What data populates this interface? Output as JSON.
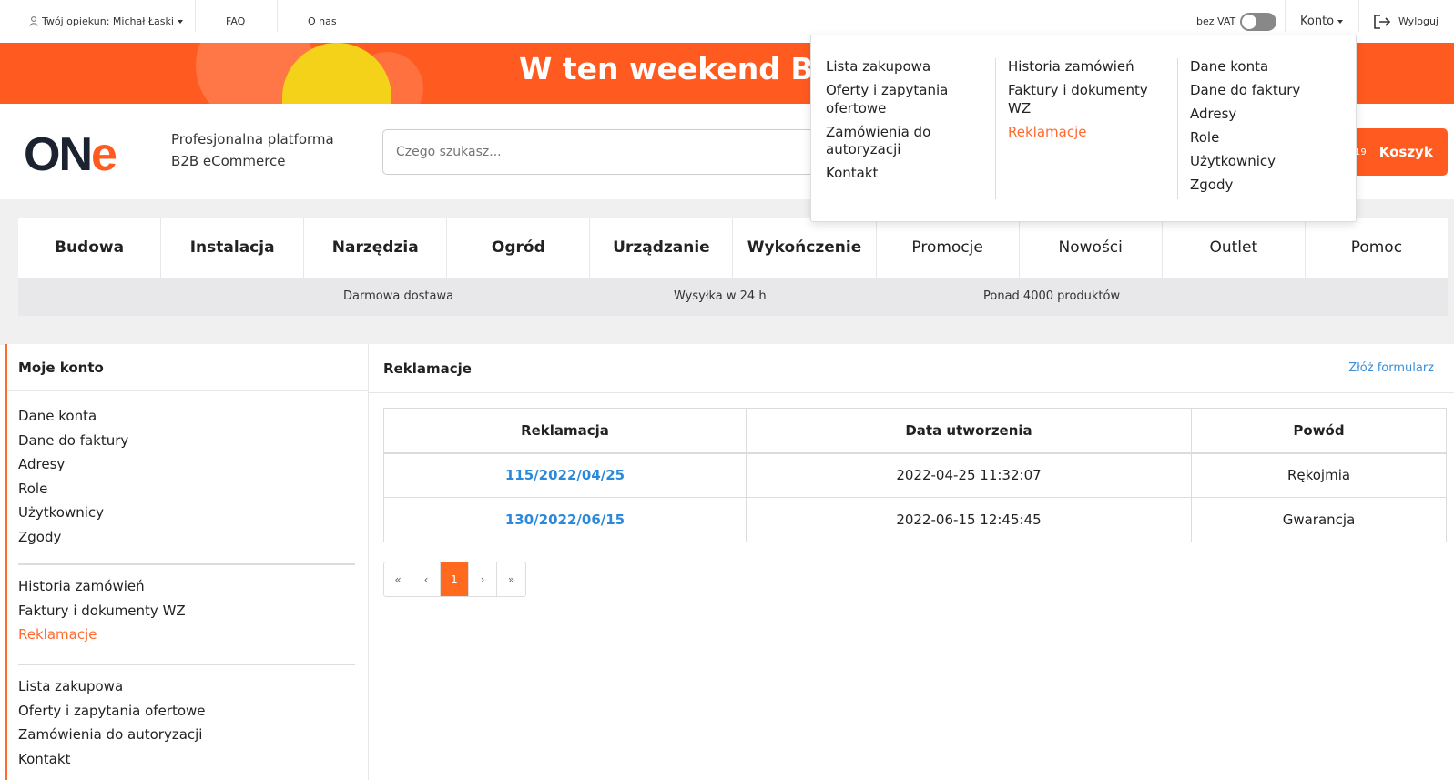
{
  "topbar": {
    "advisor": "Twój opiekun: Michał Łaski",
    "faq": "FAQ",
    "about": "O nas",
    "vat_label": "bez VAT",
    "account": "Konto",
    "logout": "Wyloguj"
  },
  "banner": {
    "text": "W ten weekend BHP"
  },
  "header": {
    "logo_main": "ON",
    "logo_accent": "e",
    "tagline_line1": "Profesjonalna platforma",
    "tagline_line2": "B2B eCommerce",
    "search_placeholder": "Czego szukasz...",
    "cart_count": "19",
    "cart_label": "Koszyk"
  },
  "nav": {
    "items": [
      "Budowa",
      "Instalacja",
      "Narzędzia",
      "Ogród",
      "Urządzanie",
      "Wykończenie",
      "Promocje",
      "Nowości",
      "Outlet",
      "Pomoc"
    ]
  },
  "perks": [
    "Darmowa dostawa",
    "Wysyłka w 24 h",
    "Ponad 4000 produktów"
  ],
  "sidebar": {
    "title": "Moje konto",
    "group1": [
      "Dane konta",
      "Dane do faktury",
      "Adresy",
      "Role",
      "Użytkownicy",
      "Zgody"
    ],
    "group2": [
      "Historia zamówień",
      "Faktury i dokumenty WZ",
      "Reklamacje"
    ],
    "group3": [
      "Lista zakupowa",
      "Oferty i zapytania ofertowe",
      "Zamówienia do autoryzacji",
      "Kontakt"
    ]
  },
  "main": {
    "title": "Reklamacje",
    "form_link": "Złóż formularz",
    "columns": [
      "Reklamacja",
      "Data utworzenia",
      "Powód"
    ],
    "rows": [
      {
        "id": "115/2022/04/25",
        "date": "2022-04-25 11:32:07",
        "reason": "Rękojmia"
      },
      {
        "id": "130/2022/06/15",
        "date": "2022-06-15 12:45:45",
        "reason": "Gwarancja"
      }
    ],
    "pager": {
      "first": "«",
      "prev": "‹",
      "current": "1",
      "next": "›",
      "last": "»"
    }
  },
  "dropdown": {
    "col1": [
      "Lista zakupowa",
      "Oferty i zapytania ofertowe",
      "Zamówienia do autoryzacji",
      "Kontakt"
    ],
    "col2": [
      "Historia zamówień",
      "Faktury i dokumenty WZ",
      "Reklamacje"
    ],
    "col3": [
      "Dane konta",
      "Dane do faktury",
      "Adresy",
      "Role",
      "Użytkownicy",
      "Zgody"
    ]
  },
  "colors": {
    "accent": "#ff5a1f",
    "link": "#2c88d9"
  }
}
